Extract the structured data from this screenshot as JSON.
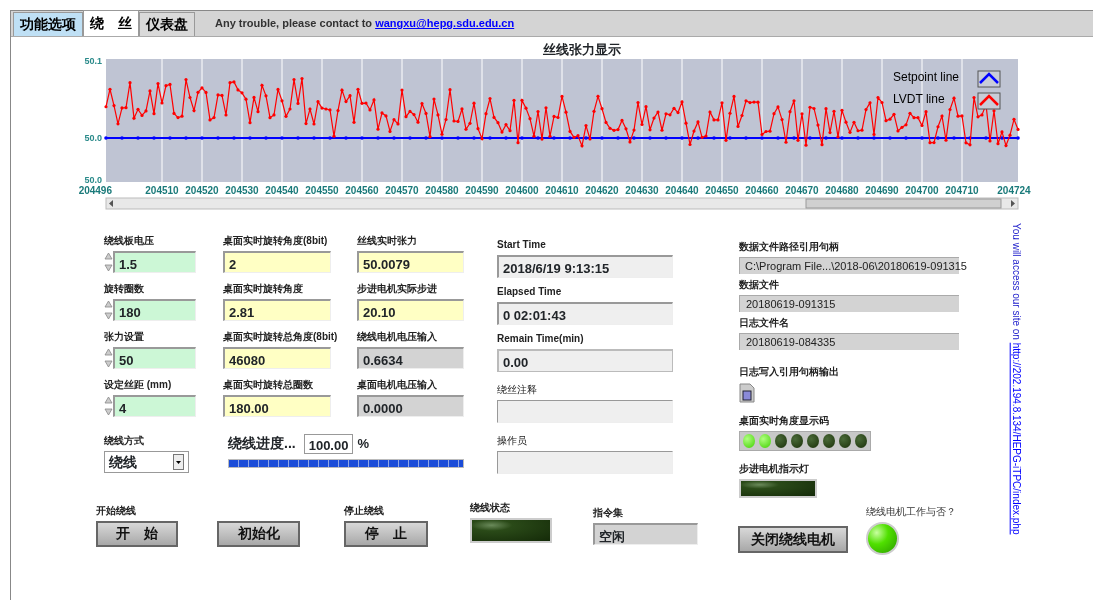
{
  "tabs": [
    {
      "label": "功能选项",
      "selected": false
    },
    {
      "label": "绕　丝",
      "selected": true
    },
    {
      "label": "仪表盘",
      "selected": false
    }
  ],
  "contact": {
    "text": "Any trouble, please contact to",
    "link": "wangxu@hepg.sdu.edu.cn"
  },
  "chart": {
    "title": "丝线张力显示",
    "yticks": [
      "50.1",
      "50.0",
      "50.0"
    ],
    "xticks": [
      "204496",
      "204510",
      "204520",
      "204530",
      "204540",
      "204550",
      "204560",
      "204570",
      "204580",
      "204590",
      "204600",
      "204610",
      "204620",
      "204630",
      "204640",
      "204650",
      "204660",
      "204670",
      "204680",
      "204690",
      "204700",
      "204710",
      "204724"
    ],
    "legend": [
      {
        "name": "Setpoint line",
        "color": "#0000ff"
      },
      {
        "name": "LVDT line",
        "color": "#ff0000"
      }
    ]
  },
  "setpoints": [
    {
      "label": "绕线板电压",
      "value": "1.5"
    },
    {
      "label": "旋转圈数",
      "value": "180"
    },
    {
      "label": "张力设置",
      "value": "50"
    },
    {
      "label": "设定丝距 (mm)",
      "value": "4"
    }
  ],
  "table_readings": [
    {
      "label": "桌面实时旋转角度(8bit)",
      "value": "2"
    },
    {
      "label": "桌面实时旋转角度",
      "value": "2.81"
    },
    {
      "label": "桌面实时旋转总角度(8bit)",
      "value": "46080"
    },
    {
      "label": "桌面实时旋转总圈数",
      "value": "180.00"
    }
  ],
  "wire_readings": [
    {
      "label": "丝线实时张力",
      "value": "50.0079",
      "kind": "indicator"
    },
    {
      "label": "步进电机实际步进",
      "value": "20.10",
      "kind": "indicator"
    },
    {
      "label": "绕线电机电压输入",
      "value": "0.6634",
      "kind": "input"
    },
    {
      "label": "桌面电机电压输入",
      "value": "0.0000",
      "kind": "input"
    }
  ],
  "winding_mode": {
    "label": "绕线方式",
    "value": "绕线"
  },
  "progress": {
    "label": "绕线进度...",
    "value": "100.00",
    "unit": "%",
    "level": 1.0
  },
  "times": [
    {
      "label": "Start Time",
      "value": "2018/6/19 9:13:15"
    },
    {
      "label": "Elapsed Time",
      "value": "0  02:01:43"
    },
    {
      "label": "Remain Time(min)",
      "value": "0.00"
    },
    {
      "label": "绕丝注释"
    },
    {
      "label": "操作员"
    }
  ],
  "files": [
    {
      "label": "数据文件路径引用句柄",
      "value": "C:\\Program File...\\2018-06\\20180619-091315"
    },
    {
      "label": "数据文件",
      "value": "20180619-091315"
    },
    {
      "label": "日志文件名",
      "value": "20180619-084335"
    }
  ],
  "log_ref": {
    "label": "日志写入引用句柄输出"
  },
  "angle_leds": {
    "label": "桌面实时角度显示码",
    "leds": [
      {
        "on": true
      },
      {
        "on": true
      },
      {
        "on": false
      },
      {
        "on": false
      },
      {
        "on": false
      },
      {
        "on": false
      },
      {
        "on": false
      },
      {
        "on": false
      }
    ]
  },
  "stepper_lamp": {
    "label": "步进电机指示灯",
    "on": false
  },
  "start_button": {
    "label": "开始绕线",
    "text": "开　始"
  },
  "init_button": {
    "text": "初始化"
  },
  "stop_button": {
    "label": "停止绕线",
    "text": "停　止"
  },
  "status_lamp": {
    "label": "绕线状态",
    "on": false
  },
  "command": {
    "label": "指令集",
    "value": "空闲"
  },
  "motor_button": {
    "text": "关闭绕线电机"
  },
  "motor_lamp": {
    "label": "绕线电机工作与否？",
    "on": true
  },
  "site_note": {
    "text": "You will access our site on",
    "link": "http://202.194.8.134/HEPG-iTPC/index.php"
  }
}
